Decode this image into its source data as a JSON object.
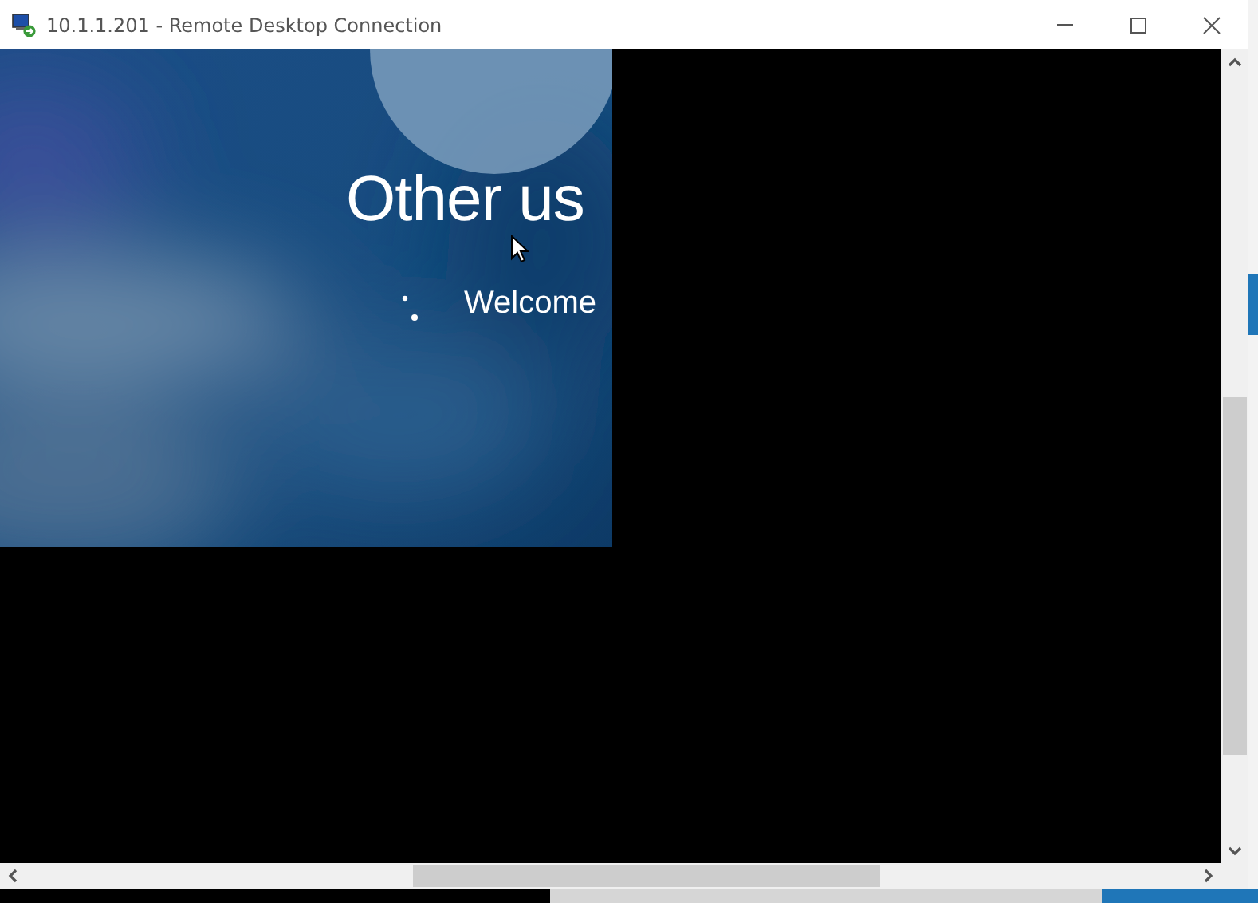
{
  "window": {
    "title": "10.1.1.201 - Remote Desktop Connection"
  },
  "remote_screen": {
    "heading": "Other us",
    "status": "Welcome",
    "busy": true
  }
}
